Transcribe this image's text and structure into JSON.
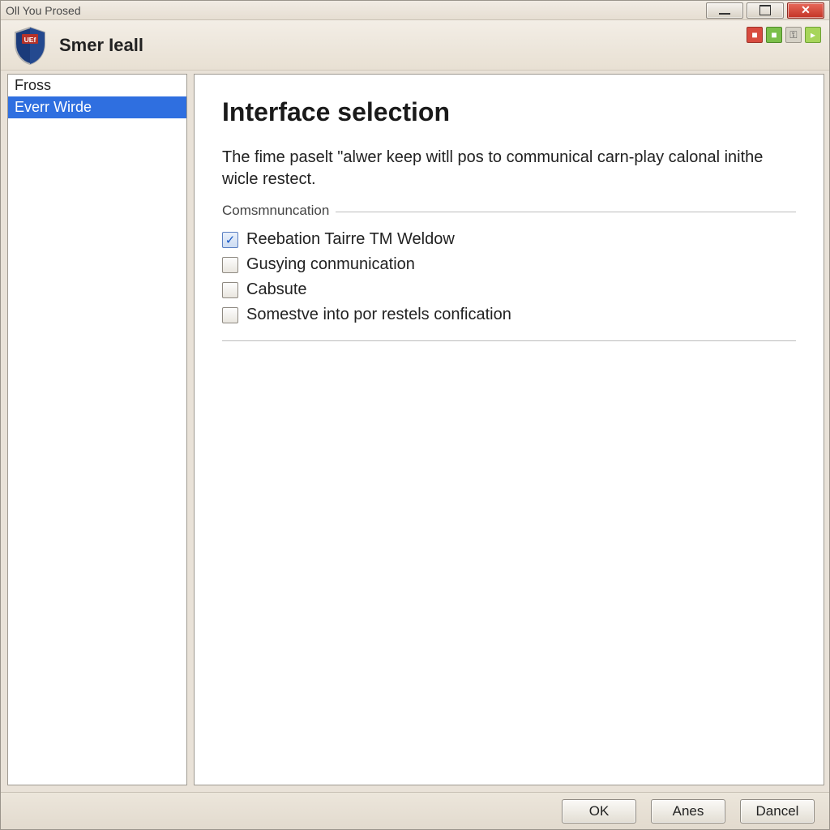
{
  "window": {
    "title": "Oll You Prosed"
  },
  "header": {
    "appname": "Smer Ieall",
    "logo_text": "UEf"
  },
  "sidebar": {
    "items": [
      {
        "label": "Fross",
        "selected": false
      },
      {
        "label": "Everr Wirde",
        "selected": true
      }
    ]
  },
  "main": {
    "title": "Interface selection",
    "description": "The fime paselt \"alwer keep witll pos to communical carn-play calonal inithe wicle restect.",
    "group_legend": "Comsmnuncation",
    "options": [
      {
        "label": "Reebation Tairre TM Weldow",
        "checked": true
      },
      {
        "label": "Gusying conmunication",
        "checked": false
      },
      {
        "label": "Cabsute",
        "checked": false
      },
      {
        "label": "Somestve into por restels confication",
        "checked": false
      }
    ]
  },
  "footer": {
    "ok_label": "OK",
    "apply_label": "Anes",
    "cancel_label": "Dancel"
  }
}
